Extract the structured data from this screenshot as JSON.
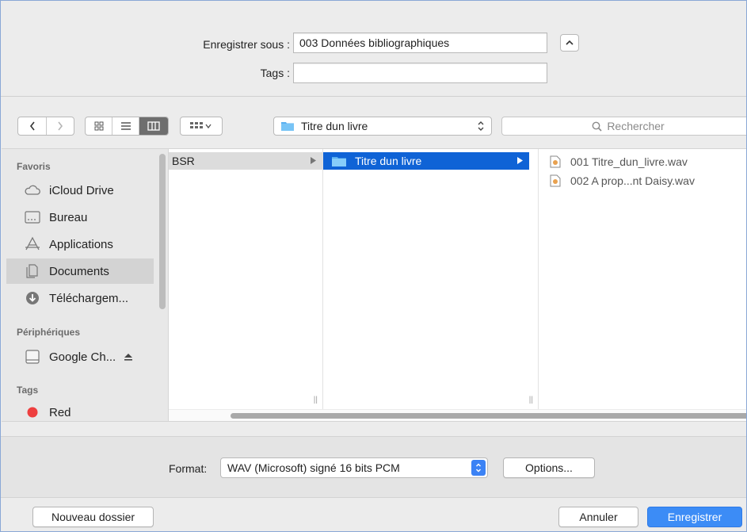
{
  "save_as": {
    "label": "Enregistrer sous :",
    "value": "003 Données bibliographiques",
    "tags_label": "Tags :",
    "tags_value": ""
  },
  "toolbar": {
    "location": "Titre dun livre",
    "search_placeholder": "Rechercher"
  },
  "sidebar": {
    "favorites_heading": "Favoris",
    "favorites": [
      {
        "label": "iCloud Drive",
        "icon": "cloud-icon"
      },
      {
        "label": "Bureau",
        "icon": "desktop-icon"
      },
      {
        "label": "Applications",
        "icon": "applications-icon"
      },
      {
        "label": "Documents",
        "icon": "documents-icon",
        "selected": true
      },
      {
        "label": "Téléchargem...",
        "icon": "downloads-icon"
      }
    ],
    "devices_heading": "Périphériques",
    "devices": [
      {
        "label": "Google Ch...",
        "icon": "drive-icon"
      }
    ],
    "tags_heading": "Tags",
    "tags": [
      {
        "label": "Red",
        "color": "#ee3f3f"
      }
    ]
  },
  "columns": {
    "col1_item": "BSR",
    "col2_item": "Titre dun livre",
    "files": [
      "001 Titre_dun_livre.wav",
      "002 A prop...nt Daisy.wav"
    ]
  },
  "format": {
    "label": "Format:",
    "value": "WAV (Microsoft) signé 16 bits PCM",
    "options_label": "Options..."
  },
  "buttons": {
    "new_folder": "Nouveau dossier",
    "cancel": "Annuler",
    "save": "Enregistrer"
  },
  "colors": {
    "accent": "#3c8cf6",
    "selection": "#0f63d6",
    "tag_red": "#ee3f3f"
  }
}
